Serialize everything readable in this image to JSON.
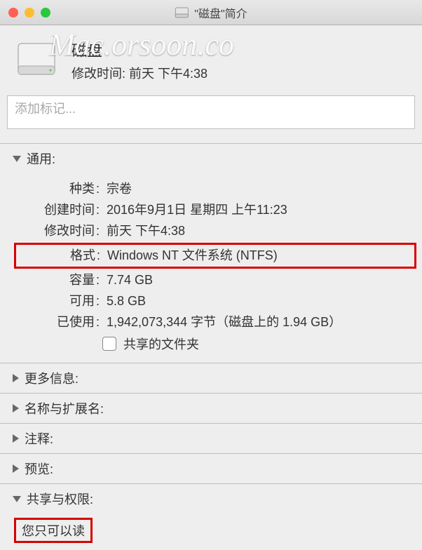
{
  "titlebar": {
    "title": "\"磁盘\"简介"
  },
  "watermark": "Mac.orsoon.co",
  "header": {
    "name": "磁盘",
    "modified_label": "修改时间:",
    "modified_value": "前天 下午4:38"
  },
  "tags": {
    "placeholder": "添加标记..."
  },
  "sections": {
    "general": {
      "title": "通用:",
      "rows": {
        "kind_label": "种类",
        "kind_value": "宗卷",
        "created_label": "创建时间",
        "created_value": "2016年9月1日 星期四 上午11:23",
        "modified_label": "修改时间",
        "modified_value": "前天 下午4:38",
        "format_label": "格式",
        "format_value": "Windows NT 文件系统 (NTFS)",
        "capacity_label": "容量",
        "capacity_value": "7.74 GB",
        "available_label": "可用",
        "available_value": "5.8 GB",
        "used_label": "已使用",
        "used_value": "1,942,073,344 字节（磁盘上的 1.94 GB）",
        "shared_label": "共享的文件夹"
      }
    },
    "more_info": {
      "title": "更多信息:"
    },
    "name_ext": {
      "title": "名称与扩展名:"
    },
    "comments": {
      "title": "注释:"
    },
    "preview": {
      "title": "预览:"
    },
    "sharing": {
      "title": "共享与权限:",
      "permission_text": "您只可以读"
    }
  }
}
